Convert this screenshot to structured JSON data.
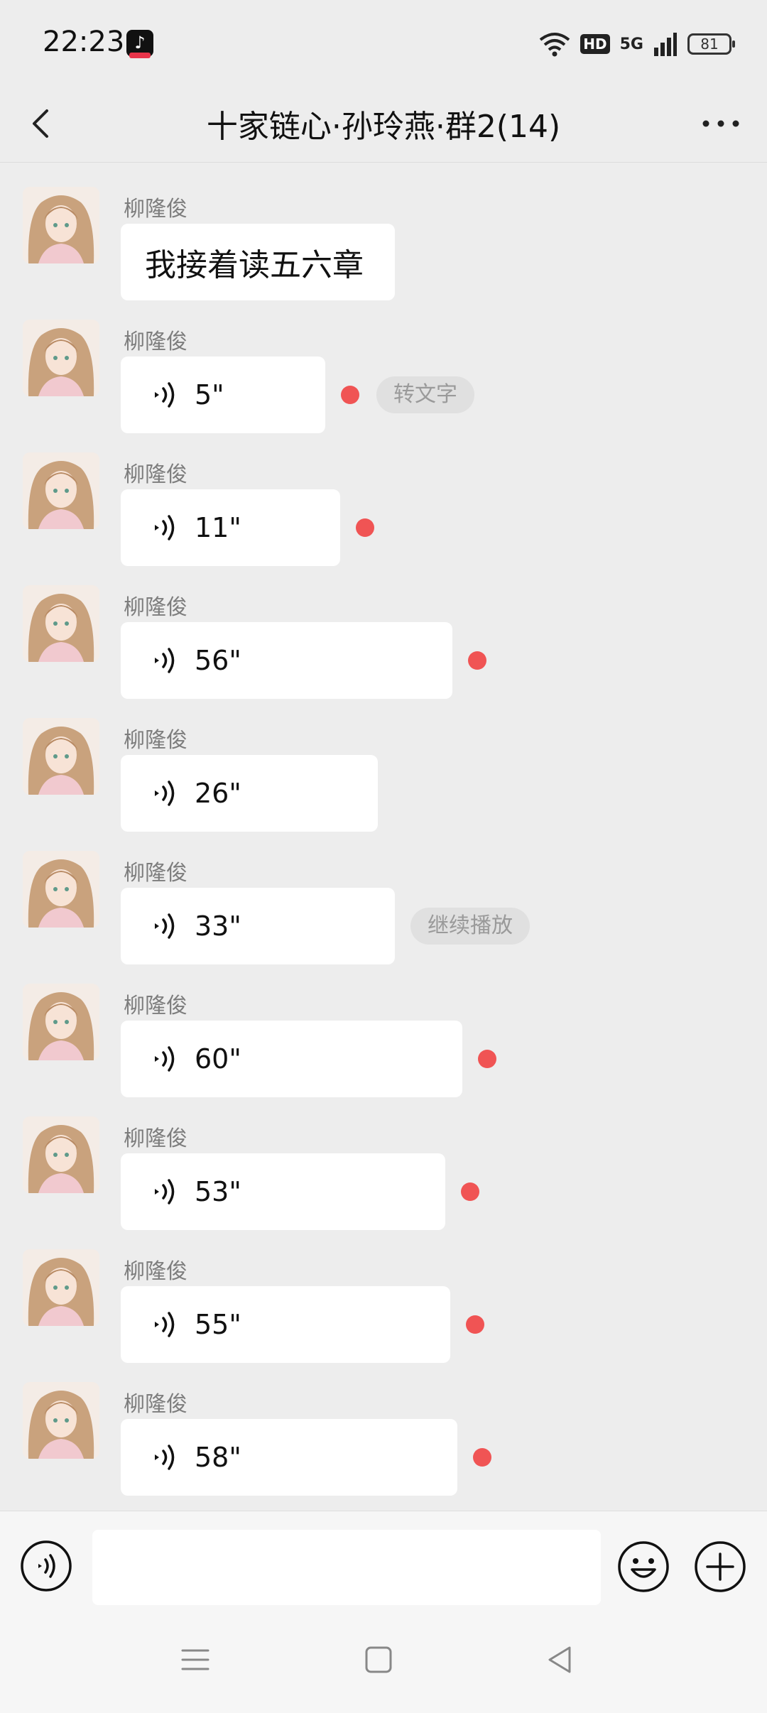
{
  "status_bar": {
    "time": "22:23",
    "app_icon": "douyin-icon",
    "hd": "HD",
    "network": "5G",
    "battery": "81"
  },
  "nav": {
    "title": "十家链心·孙玲燕·群2(14)",
    "back_icon": "chevron-left-icon",
    "more_icon": "more-horizontal-icon"
  },
  "messages": [
    {
      "sender": "柳隆俊",
      "type": "text",
      "text": "我接着读五六章"
    },
    {
      "sender": "柳隆俊",
      "type": "voice",
      "duration": "5\"",
      "unread": true,
      "action": "转文字"
    },
    {
      "sender": "柳隆俊",
      "type": "voice",
      "duration": "11\"",
      "unread": true
    },
    {
      "sender": "柳隆俊",
      "type": "voice",
      "duration": "56\"",
      "unread": true
    },
    {
      "sender": "柳隆俊",
      "type": "voice",
      "duration": "26\"",
      "unread": false
    },
    {
      "sender": "柳隆俊",
      "type": "voice",
      "duration": "33\"",
      "unread": false,
      "action": "继续播放"
    },
    {
      "sender": "柳隆俊",
      "type": "voice",
      "duration": "60\"",
      "unread": true
    },
    {
      "sender": "柳隆俊",
      "type": "voice",
      "duration": "53\"",
      "unread": true
    },
    {
      "sender": "柳隆俊",
      "type": "voice",
      "duration": "55\"",
      "unread": true
    },
    {
      "sender": "柳隆俊",
      "type": "voice",
      "duration": "58\"",
      "unread": true
    }
  ],
  "input_bar": {
    "voice_icon": "voice-input-icon",
    "text_value": "",
    "emoji_icon": "emoji-icon",
    "plus_icon": "plus-circle-icon"
  },
  "system_nav": {
    "menu_icon": "menu-icon",
    "home_icon": "home-square-icon",
    "back_icon": "back-triangle-icon"
  },
  "colors": {
    "background": "#ededed",
    "bubble": "#ffffff",
    "unread_dot": "#f05454",
    "sender_name": "#7d7d7d"
  }
}
